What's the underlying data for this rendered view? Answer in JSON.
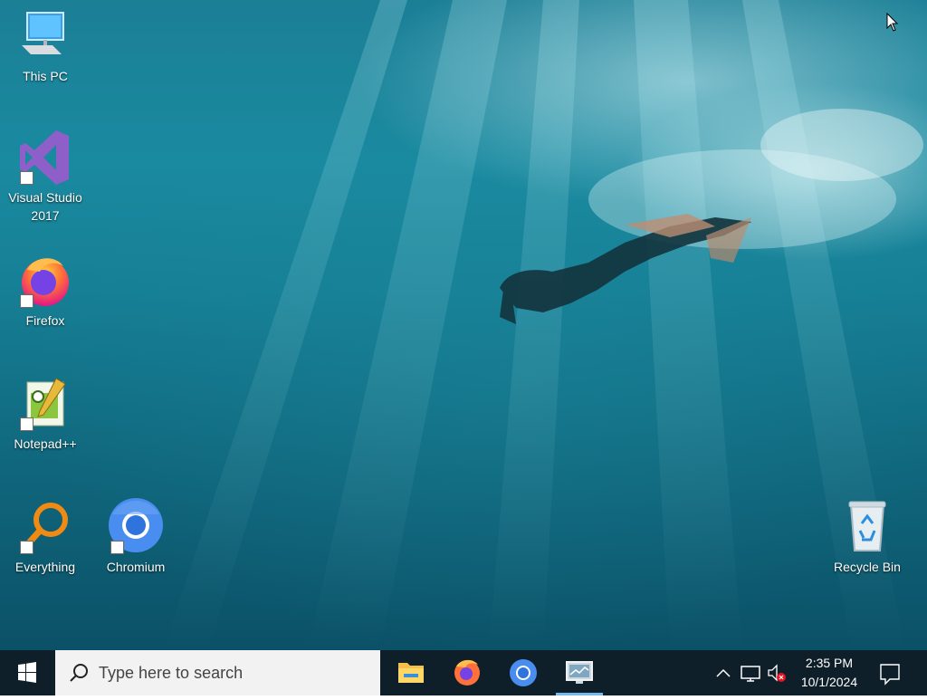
{
  "desktop": {
    "icons": [
      {
        "label": "This PC",
        "icon": "this-pc-icon"
      },
      {
        "label": "Visual Studio 2017",
        "label_line1": "Visual Studio",
        "label_line2": "2017",
        "icon": "visual-studio-icon"
      },
      {
        "label": "Firefox",
        "icon": "firefox-icon"
      },
      {
        "label": "Notepad++",
        "icon": "notepad-plus-plus-icon"
      },
      {
        "label": "Everything",
        "icon": "everything-search-icon"
      },
      {
        "label": "Chromium",
        "icon": "chromium-icon"
      },
      {
        "label": "Recycle Bin",
        "icon": "recycle-bin-icon"
      }
    ]
  },
  "taskbar": {
    "start_icon": "windows-logo-icon",
    "search_placeholder": "Type here to search",
    "pinned": [
      {
        "name": "File Explorer",
        "icon": "file-explorer-icon"
      },
      {
        "name": "Firefox",
        "icon": "firefox-icon"
      },
      {
        "name": "Chromium",
        "icon": "chromium-icon"
      },
      {
        "name": "Remote Desktop",
        "icon": "remote-desktop-icon",
        "active": true
      }
    ],
    "tray": {
      "icons": [
        "chevron-up-icon",
        "network-icon",
        "volume-muted-icon"
      ],
      "time": "2:35 PM",
      "date": "10/1/2024",
      "notification_icon": "action-center-icon"
    }
  },
  "colors": {
    "taskbar_bg": "#0f1f2a",
    "search_bg": "#f2f2f2",
    "active_indicator": "#76b9ed"
  }
}
